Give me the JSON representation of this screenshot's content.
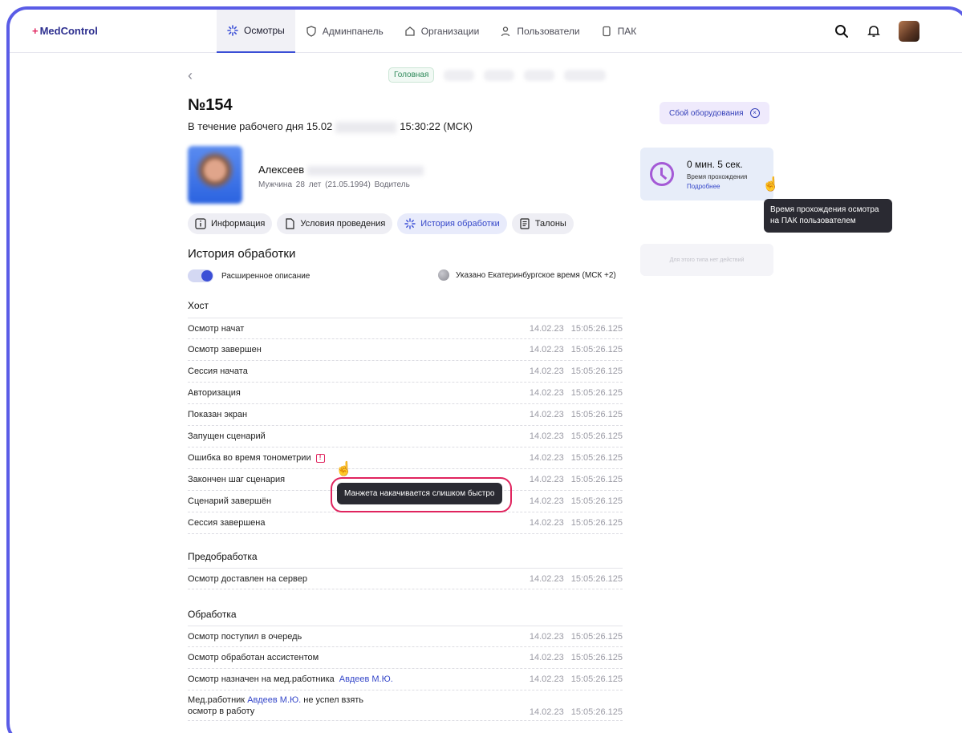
{
  "brand": {
    "logo_plus": "+",
    "logo_text": "MedControl",
    "accent": "#3b4fd6",
    "alert": "#e0245e"
  },
  "nav": [
    {
      "label": "Осмотры",
      "icon": "loader-icon",
      "active": true
    },
    {
      "label": "Админпанель",
      "icon": "shield-icon"
    },
    {
      "label": "Организации",
      "icon": "home-icon"
    },
    {
      "label": "Пользователи",
      "icon": "user-icon"
    },
    {
      "label": "ПАК",
      "icon": "device-icon"
    }
  ],
  "top_actions": {
    "search": "search-icon",
    "bell": "bell-icon",
    "avatar": "avatar"
  },
  "breadcrumb": {
    "back": "‹",
    "main": "Головная"
  },
  "exam": {
    "title": "№154",
    "subtitle_prefix": "В течение рабочего дня  15.02",
    "subtitle_time": "15:30:22 (МСК)"
  },
  "person": {
    "name": "Алексеев",
    "meta": "Мужчина   28 лет (21.05.1994)   Водитель"
  },
  "tabs": [
    {
      "label": "Информация",
      "icon": "info-icon"
    },
    {
      "label": "Условия проведения",
      "icon": "document-icon"
    },
    {
      "label": "История обработки",
      "icon": "loader-icon",
      "active": true
    },
    {
      "label": "Талоны",
      "icon": "ticket-icon"
    }
  ],
  "history": {
    "title": "История обработки",
    "toggle_label": "Расширенное описание",
    "timezone": "Указано Екатеринбургское время (МСК +2)"
  },
  "groups": {
    "host": {
      "title": "Хост",
      "rows": [
        {
          "label": "Осмотр начат",
          "date": "14.02.23",
          "time": "15:05:26.125"
        },
        {
          "label": "Осмотр завершен",
          "date": "14.02.23",
          "time": "15:05:26.125"
        },
        {
          "label": "Сессия начата",
          "date": "14.02.23",
          "time": "15:05:26.125"
        },
        {
          "label": "Авторизация",
          "date": "14.02.23",
          "time": "15:05:26.125"
        },
        {
          "label": "Показан экран",
          "date": "14.02.23",
          "time": "15:05:26.125"
        },
        {
          "label": "Запущен сценарий",
          "date": "14.02.23",
          "time": "15:05:26.125"
        },
        {
          "label": "Ошибка во время тонометрии",
          "date": "14.02.23",
          "time": "15:05:26.125",
          "warn": "!"
        },
        {
          "label": "Закончен шаг сценария",
          "date": "14.02.23",
          "time": "15:05:26.125"
        },
        {
          "label": "Сценарий завершён",
          "date": "14.02.23",
          "time": "15:05:26.125"
        },
        {
          "label": "Сессия завершена",
          "date": "14.02.23",
          "time": "15:05:26.125"
        }
      ]
    },
    "pre": {
      "title": "Предобработка",
      "rows": [
        {
          "label": "Осмотр доставлен на сервер",
          "date": "14.02.23",
          "time": "15:05:26.125"
        }
      ]
    },
    "proc": {
      "title": "Обработка",
      "rows": [
        {
          "label": "Осмотр поступил в очередь",
          "date": "14.02.23",
          "time": "15:05:26.125"
        },
        {
          "label": "Осмотр обработан ассистентом",
          "date": "14.02.23",
          "time": "15:05:26.125"
        },
        {
          "label": "Осмотр назначен на мед.работника",
          "link": "Авдеев М.Ю.",
          "date": "14.02.23",
          "time": "15:05:26.125"
        },
        {
          "label": "Мед.работник",
          "link": "Авдеев М.Ю.",
          "label_after": " не успел взять",
          "label_line2": "осмотр в работу",
          "date": "14.02.23",
          "time": "15:05:26.125"
        }
      ]
    }
  },
  "error_tooltip": "Манжета накачивается слишком быстро",
  "side": {
    "equipment_badge": "Сбой оборудования",
    "time_main": "0 мин. 5 сек.",
    "time_sub": "Время прохождения",
    "time_link": "Подробнее",
    "time_tooltip": "Время прохождения осмотра на ПАК пользователем",
    "no_actions": "Для этого типа нет действий"
  }
}
